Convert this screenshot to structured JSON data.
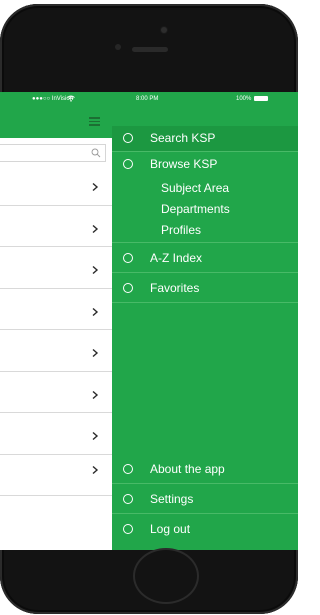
{
  "status_bar": {
    "carrier": "●●●○○ InVision",
    "time": "8:00 PM",
    "battery": "100%"
  },
  "search": {
    "placeholder": ""
  },
  "list": {
    "row_count": 8
  },
  "menu": {
    "items": [
      {
        "label": "Search KSP",
        "icon": "circle-icon",
        "selected": true
      },
      {
        "label": "Browse KSP",
        "icon": "circle-icon",
        "children": [
          "Subject Area",
          "Departments",
          "Profiles"
        ]
      },
      {
        "label": "A-Z Index",
        "icon": "circle-icon"
      },
      {
        "label": "Favorites",
        "icon": "circle-icon"
      }
    ],
    "bottom_items": [
      {
        "label": "About the app",
        "icon": "circle-icon"
      },
      {
        "label": "Settings",
        "icon": "circle-icon"
      },
      {
        "label": "Log out",
        "icon": "circle-icon"
      }
    ]
  },
  "colors": {
    "brand_green": "#21a64a",
    "selected_green": "#1c9841",
    "divider": "#48ba67",
    "phone_body": "#131313"
  }
}
